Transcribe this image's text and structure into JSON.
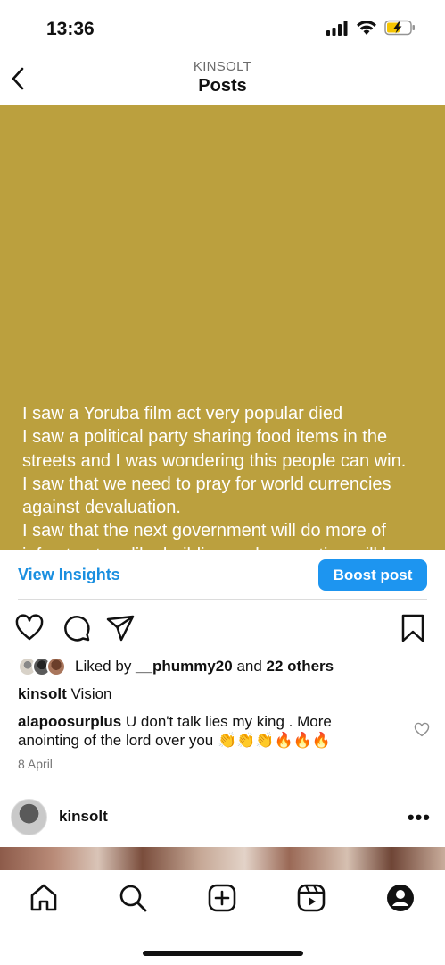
{
  "status_bar": {
    "time": "13:36"
  },
  "header": {
    "username": "KINSOLT",
    "title": "Posts"
  },
  "post": {
    "background_color": "#bba03e",
    "text": "I saw a Yoruba film act very popular died\nI saw a political party sharing food items in the streets and I was wondering this people can win.\nI saw that we need to pray for world currencies against devaluation.\nI saw that the next government will do more of infrastructure like building and renovating will be very many ."
  },
  "insights": {
    "view_insights_label": "View Insights",
    "boost_label": "Boost post"
  },
  "likes": {
    "prefix": "Liked by ",
    "user": "__phummy20",
    "middle": " and ",
    "others": "22 others"
  },
  "caption": {
    "username": "kinsolt",
    "text": " Vision"
  },
  "comment": {
    "username": "alapoosurplus",
    "text": " U don't talk lies my king . More anointing of the lord over you 👏👏👏🔥🔥🔥"
  },
  "date": "8 April",
  "next_post": {
    "username": "kinsolt"
  },
  "icons": {
    "back": "chevron-left-icon",
    "like": "heart-icon",
    "comment": "comment-icon",
    "share": "send-icon",
    "save": "bookmark-icon",
    "more": "more-icon",
    "tabs": [
      "home-icon",
      "search-icon",
      "create-icon",
      "reels-icon",
      "profile-icon"
    ]
  },
  "colors": {
    "accent_blue": "#1d95f0",
    "link_blue": "#1a8fe0"
  }
}
